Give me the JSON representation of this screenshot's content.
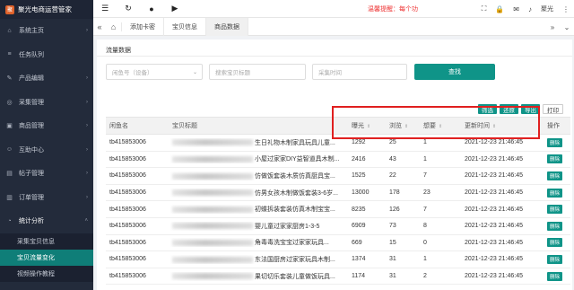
{
  "app": {
    "name": "聚光电商运营管家",
    "logo_char": "聚"
  },
  "sidebar": {
    "items": [
      {
        "label": "系统主页",
        "icon": "home-icon"
      },
      {
        "label": "任务队列",
        "icon": "list-icon"
      },
      {
        "label": "产品编辑",
        "icon": "edit-icon"
      },
      {
        "label": "采集管理",
        "icon": "collect-icon"
      },
      {
        "label": "商品管理",
        "icon": "goods-icon"
      },
      {
        "label": "互助中心",
        "icon": "help-icon"
      },
      {
        "label": "帖子管理",
        "icon": "post-icon"
      },
      {
        "label": "订单管理",
        "icon": "order-icon"
      },
      {
        "label": "统计分析",
        "icon": "stats-icon"
      }
    ],
    "sub_items": [
      {
        "label": "采集宝贝信息"
      },
      {
        "label": "宝贝流量变化"
      },
      {
        "label": "视频操作教程"
      }
    ]
  },
  "topbar": {
    "alert": "温馨提醒：每个功",
    "user": "聚光"
  },
  "tabs": [
    "添加卡密",
    "宝贝信息",
    "商品数据"
  ],
  "page": {
    "title": "流量数据",
    "filter_placeholder_1": "闲鱼号（设备）",
    "filter_placeholder_2": "搜索宝贝标题",
    "filter_placeholder_3": "采集时间",
    "search_label": "查找"
  },
  "actions": [
    "筛选",
    "还原",
    "导出",
    "打印"
  ],
  "table": {
    "headers": [
      "闲鱼名",
      "宝贝标题",
      "曝光",
      "浏览",
      "想要",
      "更新时间",
      "操作"
    ],
    "rows": [
      {
        "name": "tb415853006",
        "title": "生日礼物木制家具玩具儿童...",
        "exposure": "1292",
        "views": "25",
        "wants": "1",
        "time": "2021-12-23 21:46:45",
        "op": "删除"
      },
      {
        "name": "tb415853006",
        "title": "小屋过家家DIY益智道具木制...",
        "exposure": "2416",
        "views": "43",
        "wants": "1",
        "time": "2021-12-23 21:46:45",
        "op": "删除"
      },
      {
        "name": "tb415853006",
        "title": "仿做饭套装木质仿真厨具宝...",
        "exposure": "1525",
        "views": "22",
        "wants": "7",
        "time": "2021-12-23 21:46:45",
        "op": "删除"
      },
      {
        "name": "tb415853006",
        "title": "仿男女孩木制做饭套装3-6岁...",
        "exposure": "13000",
        "views": "178",
        "wants": "23",
        "time": "2021-12-23 21:46:45",
        "op": "删除"
      },
      {
        "name": "tb415853006",
        "title": "初蝶拆装套装仿真木制宝宝...",
        "exposure": "8235",
        "views": "126",
        "wants": "7",
        "time": "2021-12-23 21:46:45",
        "op": "删除"
      },
      {
        "name": "tb415853006",
        "title": "婴儿童过家家厨房1-3-5",
        "exposure": "6909",
        "views": "73",
        "wants": "8",
        "time": "2021-12-23 21:46:45",
        "op": "删除"
      },
      {
        "name": "tb415853006",
        "title": "角毒毒洗宝宝过家家玩具...",
        "exposure": "669",
        "views": "15",
        "wants": "0",
        "time": "2021-12-23 21:46:45",
        "op": "删除"
      },
      {
        "name": "tb415853006",
        "title": "东法国厨房过家家玩具木制...",
        "exposure": "1374",
        "views": "31",
        "wants": "1",
        "time": "2021-12-23 21:46:45",
        "op": "删除"
      },
      {
        "name": "tb415853006",
        "title": "果切切乐套装儿童做饭玩具...",
        "exposure": "1174",
        "views": "31",
        "wants": "2",
        "time": "2021-12-23 21:46:45",
        "op": "删除"
      }
    ]
  }
}
